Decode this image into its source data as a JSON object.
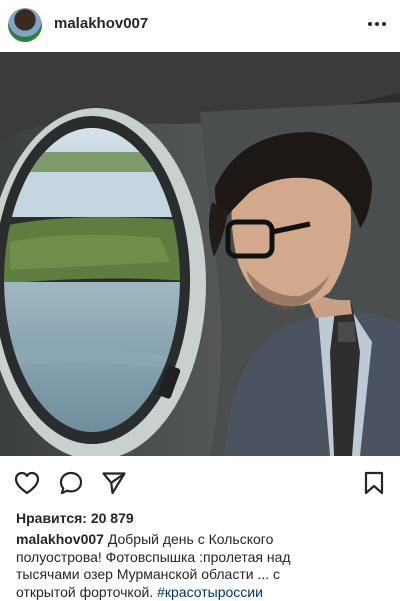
{
  "header": {
    "username": "malakhov007",
    "more_icon": "more-horizontal-icon"
  },
  "post": {
    "image_alt": "Man in glasses and suit looking out of a helicopter window at lakes and forest"
  },
  "actions": {
    "like_icon": "heart-icon",
    "comment_icon": "comment-icon",
    "share_icon": "paper-plane-icon",
    "save_icon": "bookmark-icon"
  },
  "likes": {
    "label": "Нравится: 20 879"
  },
  "caption": {
    "user": "malakhov007",
    "text": " Добрый день с Кольского полуострова! Фотовспышка :пролетая над тысячами озер Мурманской области ... с открытой форточкой. ",
    "hashtag": "#красотыроссии"
  }
}
